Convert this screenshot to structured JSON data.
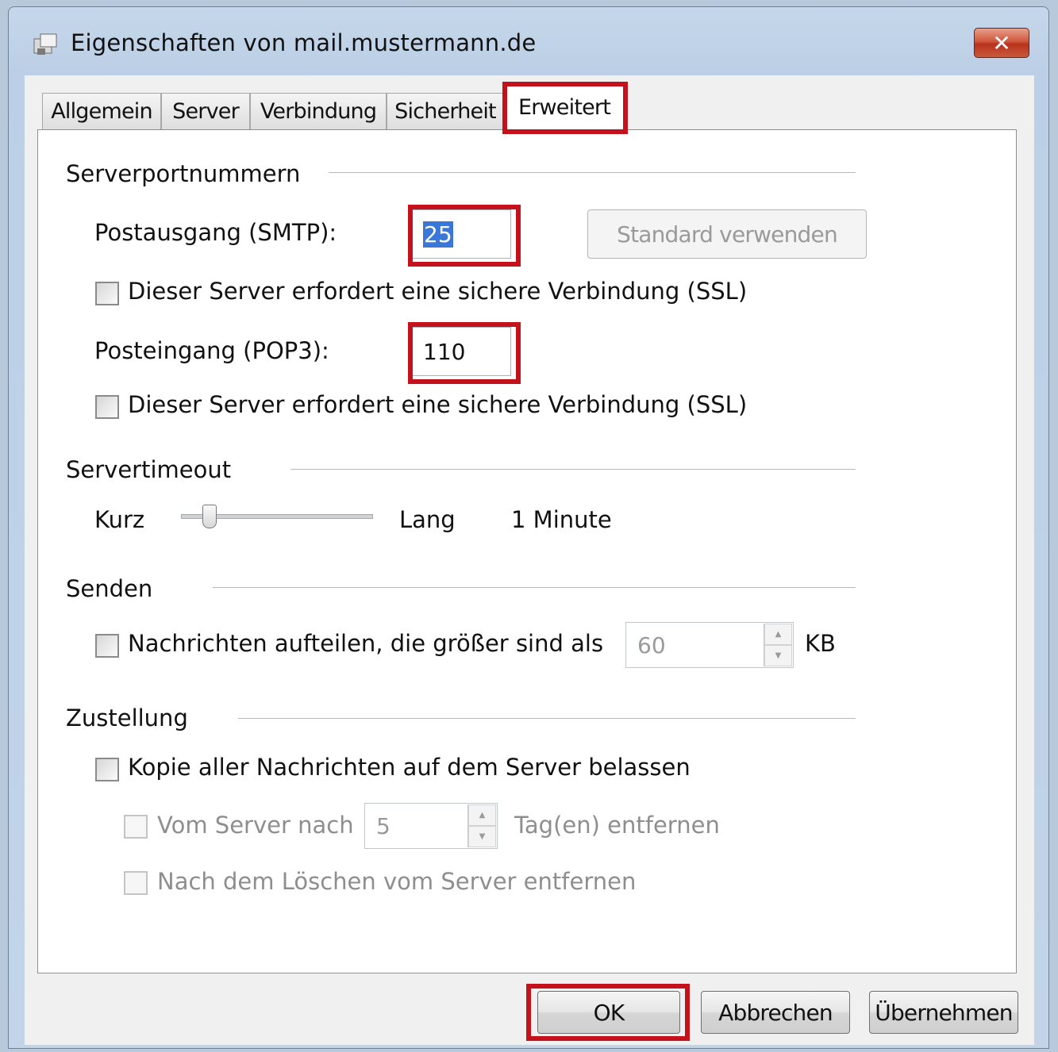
{
  "window": {
    "title": "Eigenschaften von mail.mustermann.de",
    "close_symbol": "✕"
  },
  "tabs": [
    {
      "label": "Allgemein"
    },
    {
      "label": "Server"
    },
    {
      "label": "Verbindung"
    },
    {
      "label": "Sicherheit"
    },
    {
      "label": "Erweitert"
    }
  ],
  "active_tab": "Erweitert",
  "ports": {
    "group_title": "Serverportnummern",
    "smtp_label": "Postausgang (SMTP):",
    "smtp_value": "25",
    "default_button": "Standard verwenden",
    "smtp_ssl_label": "Dieser Server erfordert eine sichere Verbindung (SSL)",
    "pop3_label": "Posteingang (POP3):",
    "pop3_value": "110",
    "pop3_ssl_label": "Dieser Server erfordert eine sichere Verbindung (SSL)"
  },
  "timeout": {
    "group_title": "Servertimeout",
    "short_label": "Kurz",
    "long_label": "Lang",
    "value_text": "1 Minute",
    "slider_level": 0.15
  },
  "send": {
    "group_title": "Senden",
    "split_label": "Nachrichten aufteilen, die größer sind als",
    "split_value": "60",
    "unit": "KB"
  },
  "delivery": {
    "group_title": "Zustellung",
    "keep_copy_label": "Kopie aller Nachrichten auf dem Server belassen",
    "remove_after_label": "Vom Server nach",
    "days_value": "5",
    "days_suffix": "Tag(en) entfernen",
    "remove_on_delete_label": "Nach dem Löschen vom Server entfernen"
  },
  "footer": {
    "ok_label": "OK",
    "cancel_label": "Abbrechen",
    "apply_label": "Übernehmen"
  },
  "colors": {
    "highlight": "#c4121d",
    "selection": "#3a77d8"
  },
  "icons": {
    "window_icon": "mail-server-icon",
    "close_icon": "close-icon"
  }
}
